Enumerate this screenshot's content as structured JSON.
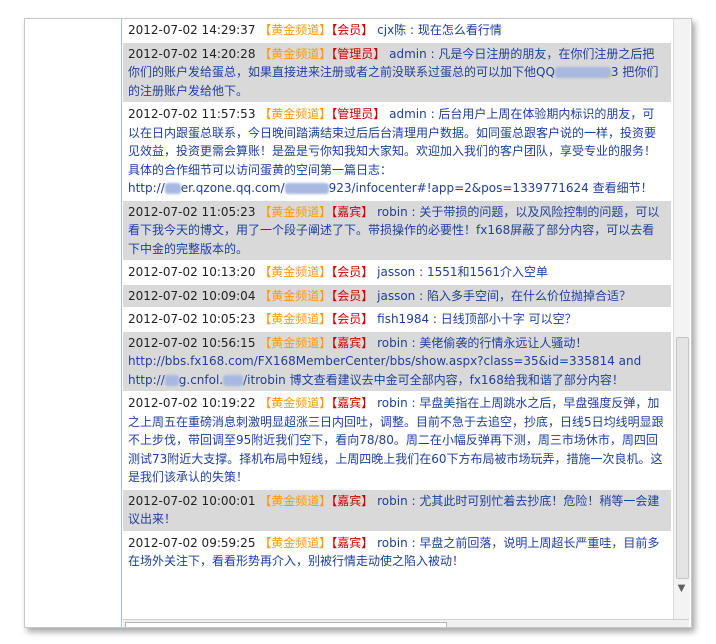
{
  "messages": [
    {
      "time": "2012-07-02 14:29:37",
      "channel": "【黄金频道】",
      "role": "【会员】",
      "user": "cjx陈",
      "text": "现在怎么看行情",
      "style": "plain"
    },
    {
      "time": "2012-07-02 14:20:28",
      "channel": "【黄金频道】",
      "role": "【管理员】",
      "user": "admin",
      "text": "凡是今日注册的朋友，在你们注册之后把你们的账户发给蛋总，如果直接进来注册或者之前没联系过蛋总的可以加下他QQ",
      "text_tail": "3 把你们的注册账户发给他下。",
      "style": "alt"
    },
    {
      "time": "2012-07-02 11:57:53",
      "channel": "【黄金频道】",
      "role": "【管理员】",
      "user": "admin",
      "text": "后台用户上周在体验期内标识的朋友，可以在日内跟蛋总联系，今日晚间踏满结束过后后台清理用户数据。如同蛋总跟客户说的一样，投资要见效益，投资更需会算账！是盈是亏你知我知大家知。欢迎加入我们的客户团队，享受专业的服务！具体的合作细节可以访问蛋黄的空间第一篇日志：",
      "link_a": "http://",
      "link_b": "er.qzone.qq.com/",
      "link_c": "923/infocenter#!app=2&pos=1339771624",
      "link_tail": " 查看细节！",
      "style": "plain"
    },
    {
      "time": "2012-07-02 11:05:23",
      "channel": "【黄金频道】",
      "role": "【嘉宾】",
      "user": "robin",
      "text": "关于带损的问题，以及风险控制的问题，可以看下我今天的博文，用了一个段子阐述了下。带损操作的必要性！fx168屏蔽了部分内容，可以去看下中金的完整版本的。",
      "style": "alt"
    },
    {
      "time": "2012-07-02 10:13:20",
      "channel": "【黄金频道】",
      "role": "【会员】",
      "user": "jasson",
      "text": "1551和1561介入空单",
      "style": "plain"
    },
    {
      "time": "2012-07-02 10:09:04",
      "channel": "【黄金频道】",
      "role": "【会员】",
      "user": "jasson",
      "text": "陷入多手空间，在什么价位抛掉合适？",
      "style": "alt"
    },
    {
      "time": "2012-07-02 10:05:23",
      "channel": "【黄金频道】",
      "role": "【会员】",
      "user": "fish1984",
      "text": "日线顶部小十字 可以空？",
      "style": "plain"
    },
    {
      "time": "2012-07-02 10:56:15",
      "channel": "【黄金频道】",
      "role": "【嘉宾】",
      "user": "robin",
      "text": "美佬偷袭的行情永远让人骚动！",
      "link_1": "http://bbs.fx168.com/FX168MemberCenter/bbs/show.aspx?class=35&id=335814 and",
      "link_2a": "http://",
      "link_2b": "g.cnfol.",
      "link_2c": "/itrobin",
      "link_2_tail": " 博文查看建议去中金可全部内容，fx168给我和谐了部分内容！",
      "style": "alt"
    },
    {
      "time": "2012-07-02 10:19:22",
      "channel": "【黄金频道】",
      "role": "【嘉宾】",
      "user": "robin",
      "text": "早盘美指在上周跳水之后，早盘强度反弹，加之上周五在重磅消息刺激明显超涨三日内回吐，调整。目前不急于去追空，抄底，日线5日均线明显跟不上步伐，带回调至95附近我们空下，看向78/80。周二在小幅反弹再下测，周三市场休市，周四回测试73附近大支撑。择机布局中短线，上周四晚上我们在60下方布局被市场玩弄，措施一次良机。这是我们该承认的失策！",
      "style": "plain"
    },
    {
      "time": "2012-07-02 10:00:01",
      "channel": "【黄金频道】",
      "role": "【嘉宾】",
      "user": "robin",
      "text": "尤其此时可别忙着去抄底！危险！稍等一会建议出来！",
      "style": "alt"
    },
    {
      "time": "2012-07-02 09:59:25",
      "channel": "【黄金频道】",
      "role": "【嘉宾】",
      "user": "robin",
      "text": "早盘之前回落，说明上周超长严重哇，目前多在场外关注下，看看形势再介入，别被行情走动使之陷入被动！",
      "style": "plain"
    }
  ],
  "separator": " : "
}
